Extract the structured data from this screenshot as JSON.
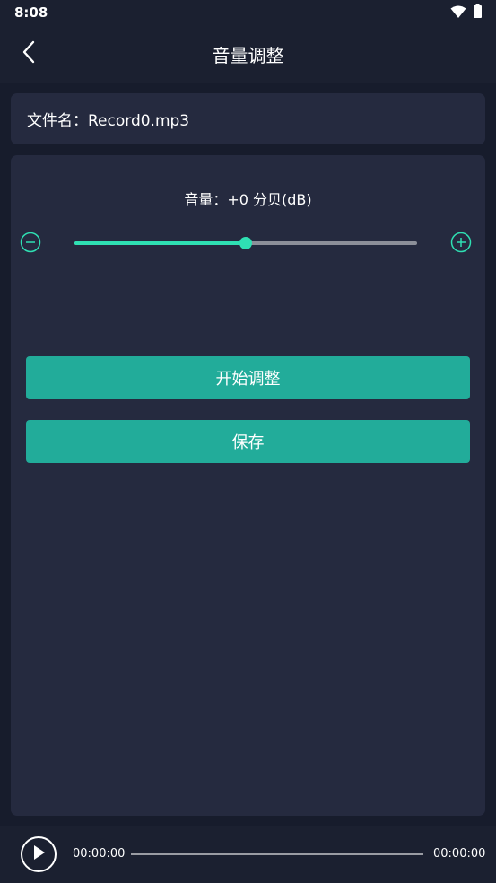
{
  "status_bar": {
    "time": "8:08",
    "icons": [
      "wifi-icon",
      "battery-icon"
    ]
  },
  "header": {
    "title": "音量调整",
    "back_icon": "chevron-left-icon"
  },
  "file": {
    "label": "文件名：Record0.mp3"
  },
  "volume": {
    "label": "音量：+0 分贝(dB)",
    "slider_fraction": 0.5,
    "minus_icon": "minus-circle-icon",
    "plus_icon": "plus-circle-icon"
  },
  "actions": {
    "start_label": "开始调整",
    "save_label": "保存"
  },
  "player": {
    "current_time": "00:00:00",
    "total_time": "00:00:00",
    "progress_fraction": 0,
    "play_icon": "play-icon"
  },
  "colors": {
    "accent": "#2fe0b3",
    "button": "#22ac9a",
    "background": "#171c2c",
    "card": "#252a3f"
  }
}
